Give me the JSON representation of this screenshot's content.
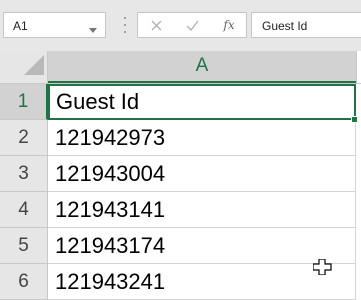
{
  "formula_bar": {
    "name_box": "A1",
    "cancel_icon": "close-icon",
    "enter_icon": "checkmark-icon",
    "fx_label": "fx",
    "formula_value": "Guest Id"
  },
  "grid": {
    "column_header": "A",
    "rows": [
      {
        "row_label": "1",
        "value": "Guest Id"
      },
      {
        "row_label": "2",
        "value": "121942973"
      },
      {
        "row_label": "3",
        "value": "121943004"
      },
      {
        "row_label": "4",
        "value": "121943141"
      },
      {
        "row_label": "5",
        "value": "121943174"
      },
      {
        "row_label": "6",
        "value": "121943241"
      }
    ]
  },
  "colors": {
    "accent": "#217346",
    "header_bg": "#e6e6e6",
    "selected_header_bg": "#d2d2d2"
  }
}
